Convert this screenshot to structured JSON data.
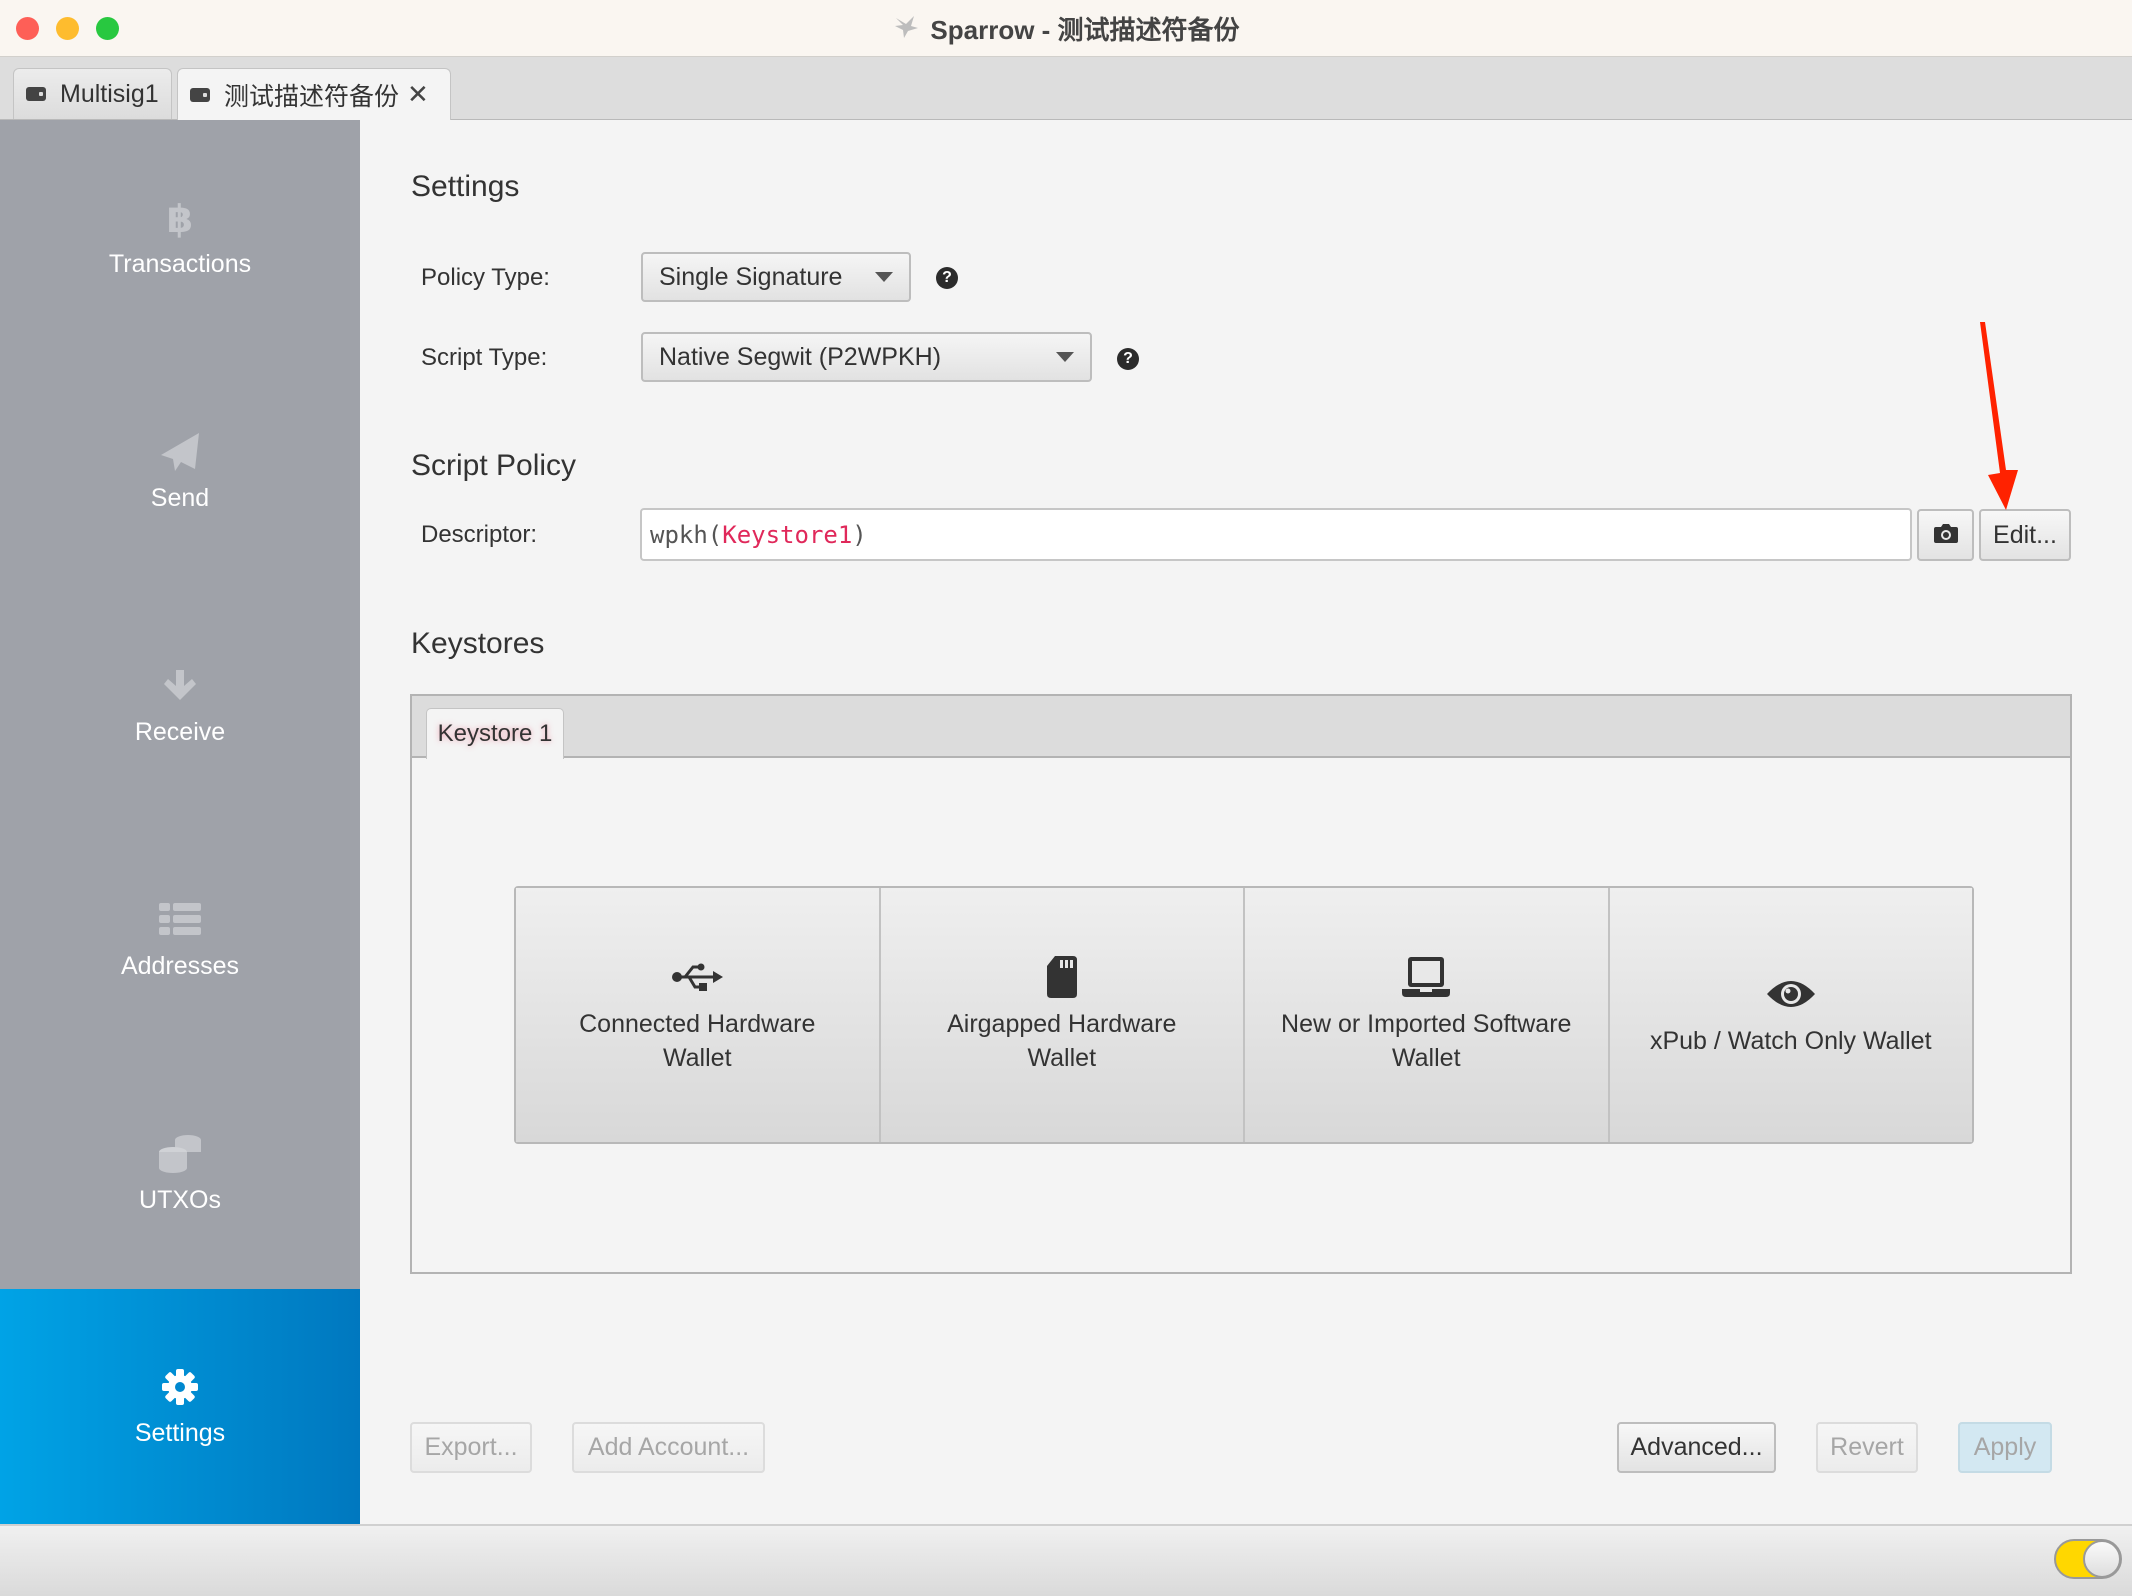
{
  "window": {
    "title": "Sparrow - 测试描述符备份",
    "app_icon": "sparrow-bird-icon"
  },
  "tabs": [
    {
      "label": "Multisig1",
      "icon": "wallet-icon",
      "active": false
    },
    {
      "label": "测试描述符备份",
      "icon": "wallet-icon",
      "active": true,
      "closable": true,
      "close_glyph": "✕"
    }
  ],
  "sidebar": {
    "items": [
      {
        "label": "Transactions",
        "icon": "bitcoin-icon",
        "selected": false
      },
      {
        "label": "Send",
        "icon": "paper-plane-icon",
        "selected": false
      },
      {
        "label": "Receive",
        "icon": "arrow-down-icon",
        "selected": false
      },
      {
        "label": "Addresses",
        "icon": "list-icon",
        "selected": false
      },
      {
        "label": "UTXOs",
        "icon": "coins-icon",
        "selected": false
      },
      {
        "label": "Settings",
        "icon": "gear-icon",
        "selected": true
      }
    ]
  },
  "settings": {
    "heading": "Settings",
    "policy_type": {
      "label": "Policy Type:",
      "value": "Single Signature",
      "help": "?"
    },
    "script_type": {
      "label": "Script Type:",
      "value": "Native Segwit (P2WPKH)",
      "help": "?"
    }
  },
  "script_policy": {
    "heading": "Script Policy",
    "descriptor_label": "Descriptor:",
    "descriptor_prefix": "wpkh(",
    "descriptor_keystore": "Keystore1",
    "descriptor_suffix": ")",
    "camera_icon": "camera-icon",
    "edit_label": "Edit..."
  },
  "keystores": {
    "heading": "Keystores",
    "tabs": [
      {
        "label": "Keystore 1"
      }
    ],
    "options": [
      {
        "icon": "usb-icon",
        "line1": "Connected Hardware",
        "line2": "Wallet"
      },
      {
        "icon": "sd-card-icon",
        "line1": "Airgapped Hardware",
        "line2": "Wallet"
      },
      {
        "icon": "laptop-icon",
        "line1": "New or Imported Software",
        "line2": "Wallet"
      },
      {
        "icon": "eye-icon",
        "line1": "xPub / Watch Only Wallet",
        "line2": ""
      }
    ]
  },
  "footer": {
    "export_label": "Export...",
    "add_account_label": "Add Account...",
    "advanced_label": "Advanced...",
    "revert_label": "Revert",
    "apply_label": "Apply"
  },
  "annotation": {
    "type": "red-arrow",
    "points_to": "Edit..."
  },
  "statusbar": {
    "toggle_on": true
  },
  "colors": {
    "accent": "#0091d6",
    "sidebar_bg": "#9fa2a9",
    "keystore_highlight": "#e0285a",
    "toggle": "#ffd700",
    "annotation": "#ff2200"
  }
}
